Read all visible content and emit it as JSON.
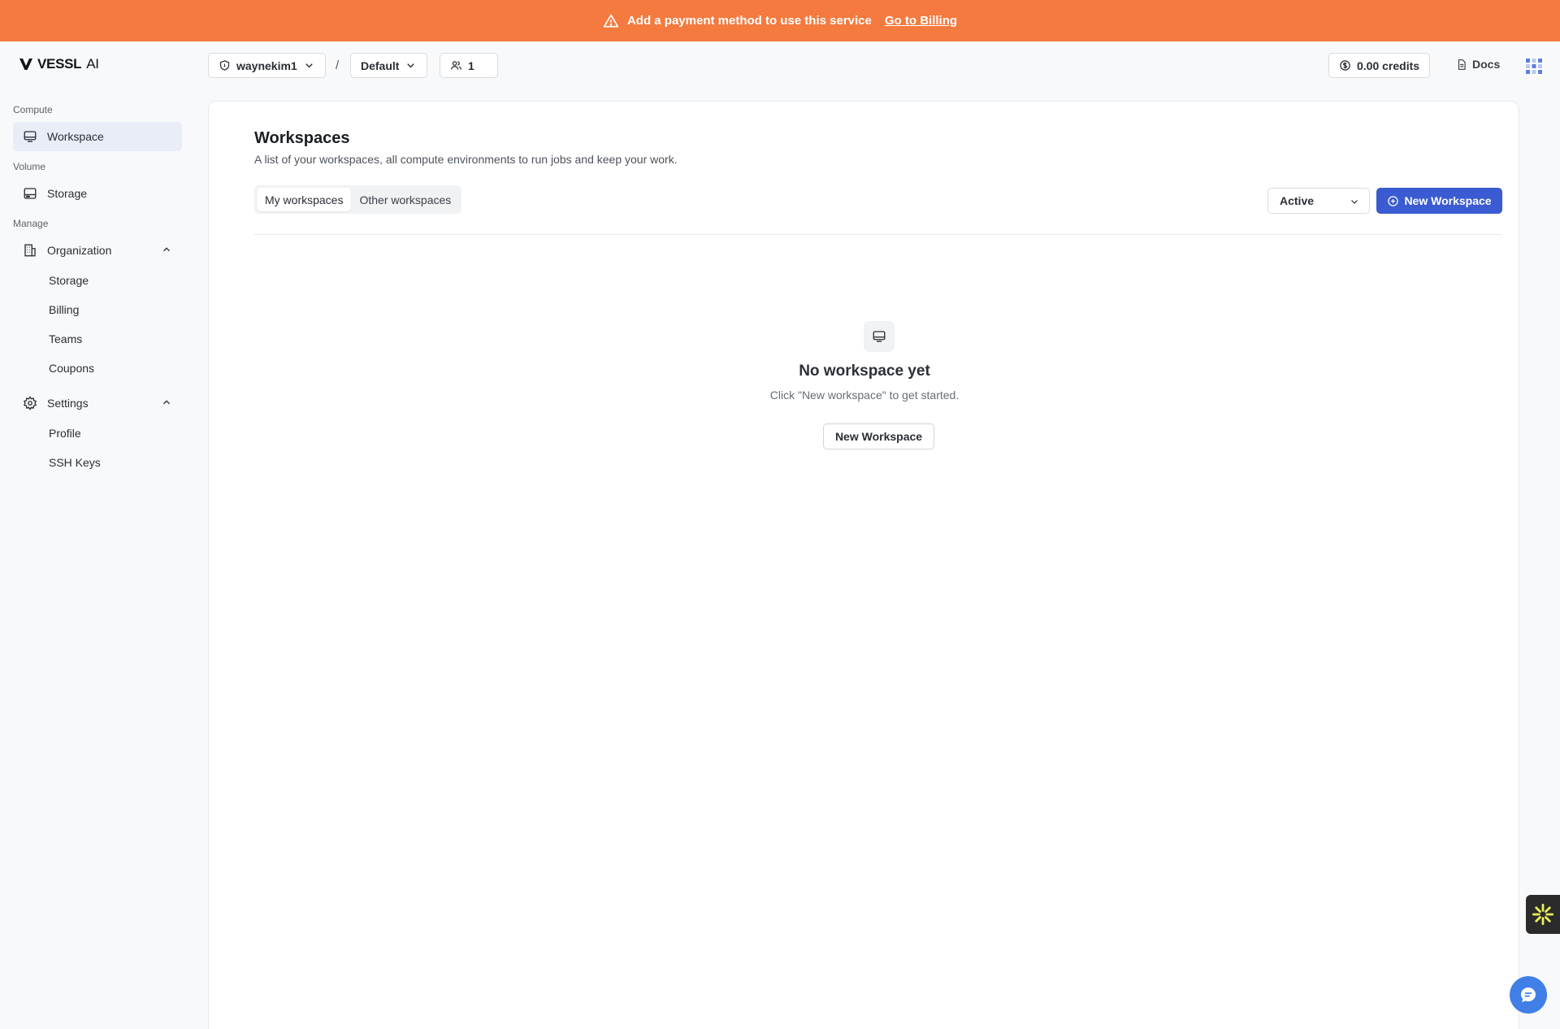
{
  "banner": {
    "message": "Add a payment method to use this service",
    "link": "Go to Billing",
    "color": "#f47a3f"
  },
  "header": {
    "logo_text": "VESSL",
    "logo_suffix": "AI",
    "org": "waynekim1",
    "separator": "/",
    "project": "Default",
    "members_count": "1",
    "credits": "0.00 credits",
    "docs": "Docs"
  },
  "sidebar": {
    "compute_label": "Compute",
    "workspace": "Workspace",
    "volume_label": "Volume",
    "storage": "Storage",
    "manage_label": "Manage",
    "organization": "Organization",
    "org_items": [
      "Storage",
      "Billing",
      "Teams",
      "Coupons"
    ],
    "settings": "Settings",
    "settings_items": [
      "Profile",
      "SSH Keys"
    ]
  },
  "main": {
    "title": "Workspaces",
    "description": "A list of your workspaces, all compute environments to run jobs and keep your work.",
    "tabs": [
      "My workspaces",
      "Other workspaces"
    ],
    "filter_value": "Active",
    "new_button": "New Workspace",
    "empty_title": "No workspace yet",
    "empty_desc": "Click \"New workspace\" to get started.",
    "empty_button": "New Workspace"
  },
  "colors": {
    "accent": "#3a5bd1",
    "active_nav_bg": "#e8edf7"
  }
}
